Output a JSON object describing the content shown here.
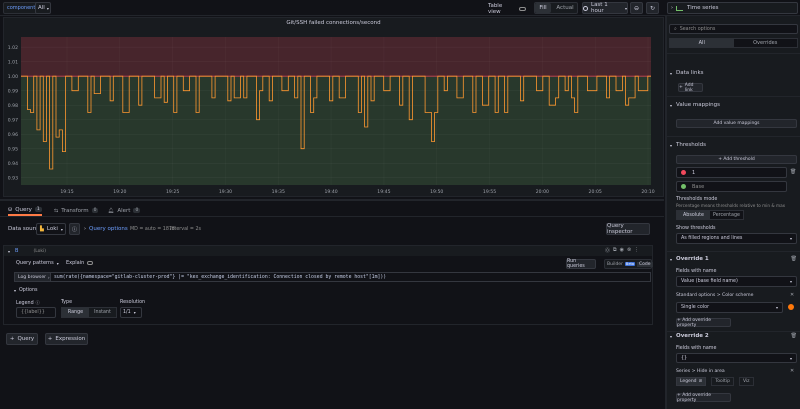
{
  "topbar": {
    "variable_label": "component",
    "variable_value": "All",
    "table_view_label": "Table view",
    "fill_label": "Fill",
    "actual_label": "Actual",
    "time_range": "Last 1 hour",
    "viz_type": "Time series"
  },
  "panel": {
    "title": "Git/SSH failed connections/second"
  },
  "chart_data": {
    "type": "line",
    "title": "Git/SSH failed connections/second",
    "x_ticks": [
      "19:15",
      "19:20",
      "19:25",
      "19:30",
      "19:35",
      "19:40",
      "19:45",
      "19:50",
      "19:55",
      "20:00",
      "20:05",
      "20:10"
    ],
    "y_ticks": [
      "1.02",
      "1.01",
      "1.00",
      "0.99",
      "0.98",
      "0.97",
      "0.96",
      "0.95",
      "0.94",
      "0.93"
    ],
    "ylim": [
      0.925,
      1.027
    ],
    "threshold": 1.0,
    "threshold_colors": {
      "above": "#f2495c",
      "below": "#73bf69"
    },
    "series": [
      {
        "color": "#ff9830",
        "values": [
          1.0,
          1.0,
          0.977,
          0.975,
          1.0,
          0.963,
          1.0,
          0.955,
          1.0,
          0.936,
          1.0,
          0.958,
          0.963,
          0.948,
          1.0,
          1.0,
          0.99,
          0.99,
          1.0,
          1.0,
          1.0,
          0.975,
          1.0,
          0.988,
          0.988,
          1.0,
          1.0,
          1.0,
          0.983,
          1.0,
          1.0,
          1.0,
          0.975,
          0.975,
          1.0,
          1.0,
          1.0,
          0.98,
          1.0,
          1.0,
          1.0,
          1.0,
          0.985,
          0.985,
          1.0,
          0.982,
          1.0,
          1.0,
          0.975,
          1.0,
          1.0,
          0.99,
          0.99,
          1.0,
          1.0,
          0.975,
          1.0,
          1.0,
          1.0,
          1.0,
          0.985,
          1.0,
          1.0,
          1.0,
          1.0,
          0.983,
          1.0,
          0.985,
          0.985,
          1.0,
          0.985,
          1.0,
          1.0,
          1.0,
          0.97,
          0.99,
          1.0,
          1.0,
          0.983,
          1.0,
          1.0,
          1.0,
          0.99,
          0.99,
          1.0,
          1.0,
          0.985,
          1.0,
          0.95,
          1.0,
          1.0,
          0.975,
          0.985,
          1.0,
          1.0,
          1.0,
          1.0,
          0.983,
          1.0,
          1.0,
          0.985,
          0.985,
          1.0,
          1.0,
          1.0,
          1.0,
          0.975,
          1.0,
          0.965,
          1.0,
          0.983,
          1.0,
          1.0,
          1.0,
          0.99,
          0.99,
          1.0,
          1.0,
          1.0,
          0.98,
          1.0,
          1.0,
          0.97,
          1.0,
          1.0,
          1.0,
          1.0,
          0.975,
          0.975,
          0.955,
          0.975,
          1.0,
          1.0,
          0.99,
          1.0,
          1.0,
          1.0,
          0.985,
          0.985,
          1.0,
          1.0,
          1.0,
          0.975,
          1.0,
          1.0,
          0.98,
          0.98,
          1.0,
          1.0,
          0.975,
          1.0,
          1.0,
          0.975,
          1.0,
          1.0,
          1.0,
          1.0,
          0.983,
          1.0,
          1.0,
          1.0,
          1.0,
          0.99,
          0.99,
          1.0,
          1.0,
          0.98,
          0.98,
          0.985,
          1.0,
          1.0,
          0.99,
          1.0,
          0.985,
          0.975,
          1.0,
          1.0,
          1.0,
          0.99,
          0.99,
          0.99,
          1.0,
          1.0,
          1.0,
          0.985,
          1.0,
          1.0,
          0.99,
          0.99,
          1.0,
          0.98,
          0.985,
          0.985,
          1.0,
          0.99,
          0.99,
          0.99,
          1.0,
          1.0
        ]
      }
    ]
  },
  "query_tabs": [
    {
      "label": "Query",
      "count": "1"
    },
    {
      "label": "Transform",
      "count": "0"
    },
    {
      "label": "Alert",
      "count": "0"
    }
  ],
  "datasource": {
    "label": "Data source",
    "name": "Loki",
    "query_options_label": "Query options",
    "query_options_detail": "MD = auto = 1878",
    "interval": "Interval = 2s",
    "inspector_label": "Query inspector"
  },
  "query": {
    "ref": "B",
    "source_hint": "(Loki)",
    "patterns_label": "Query patterns",
    "explain_label": "Explain",
    "run_label": "Run queries",
    "builder_label": "Builder",
    "beta_label": "Beta",
    "code_label": "Code",
    "log_browser_label": "Log browser",
    "expression": "sum(rate({namespace=\"gitlab-cluster-prod\"} |= \"kex_exchange_identification: Connection closed by remote host\"[1m]))",
    "options_label": "Options",
    "legend_label": "Legend",
    "legend_placeholder": "{{label}}",
    "type_label": "Type",
    "range_label": "Range",
    "instant_label": "Instant",
    "resolution_label": "Resolution",
    "resolution_value": "1/1"
  },
  "bottom_buttons": {
    "add_query": "Query",
    "add_expression": "Expression"
  },
  "options_pane": {
    "search_placeholder": "Search options",
    "tab_all": "All",
    "tab_overrides": "Overrides",
    "data_links": "Data links",
    "add_link": "Add link",
    "value_mappings": "Value mappings",
    "add_value_mappings": "Add value mappings",
    "thresholds": "Thresholds",
    "add_threshold": "+ Add threshold",
    "threshold_value": "1",
    "threshold_base": "Base",
    "thresholds_mode": "Thresholds mode",
    "thresholds_mode_desc": "Percentage means thresholds relative to min & max",
    "absolute": "Absolute",
    "percentage": "Percentage",
    "show_thresholds": "Show thresholds",
    "show_thresholds_value": "As filled regions and lines",
    "override1_title": "Override 1",
    "fields_with_name": "Fields with name",
    "override1_field_value": "Value (base field name)",
    "override1_prop_path": "Standard options > Color scheme",
    "override1_prop_value": "Single color",
    "add_override_property": "+ Add override property",
    "override2_title": "Override 2",
    "fields_with_name_2": "Fields with name",
    "override2_field_value": "{}",
    "override2_prop_path": "Series > Hide in area",
    "legend_opt": "Legend",
    "tooltip_opt": "Tooltip",
    "viz_opt": "Viz",
    "add_override_property_2": "+ Add override property"
  },
  "colors": {
    "threshold_red": "#f2495c",
    "threshold_green": "#73bf69",
    "series_orange": "#ff9830",
    "primary_blue": "#3d71d9",
    "single_color_swatch": "#ff780a"
  }
}
